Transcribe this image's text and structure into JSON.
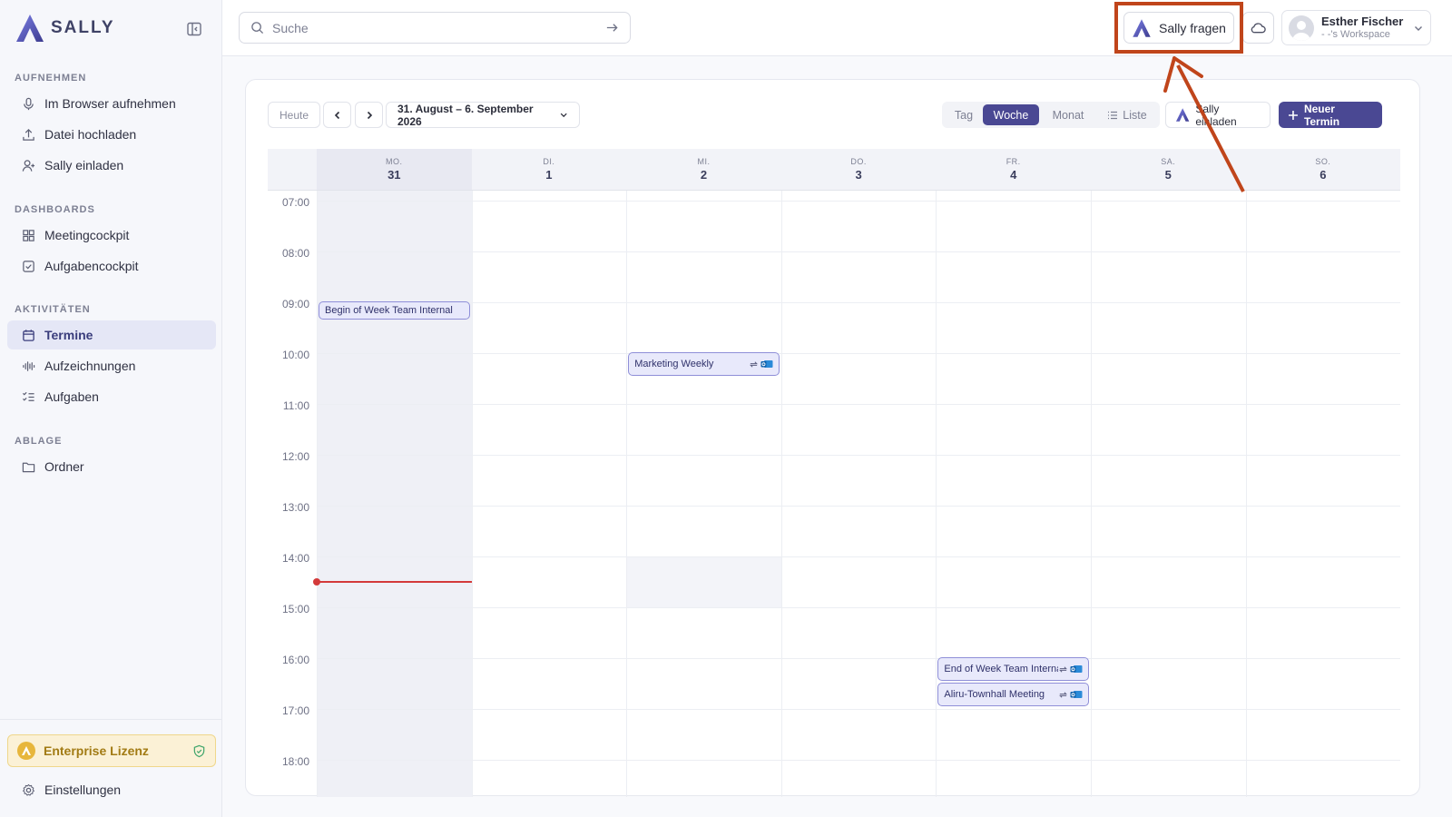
{
  "brand": {
    "name": "SALLY"
  },
  "sidebar": {
    "sections": [
      {
        "title": "AUFNEHMEN"
      },
      {
        "title": "DASHBOARDS"
      },
      {
        "title": "AKTIVITÄTEN"
      },
      {
        "title": "ABLAGE"
      }
    ],
    "items": [
      {
        "label": "Im Browser aufnehmen",
        "icon": "microphone-icon"
      },
      {
        "label": "Datei hochladen",
        "icon": "upload-icon"
      },
      {
        "label": "Sally einladen",
        "icon": "user-plus-icon"
      },
      {
        "label": "Meetingcockpit",
        "icon": "grid-icon"
      },
      {
        "label": "Aufgabencockpit",
        "icon": "checkbox-icon"
      },
      {
        "label": "Termine",
        "icon": "calendar-icon",
        "active": true
      },
      {
        "label": "Aufzeichnungen",
        "icon": "waveform-icon"
      },
      {
        "label": "Aufgaben",
        "icon": "checklist-icon"
      },
      {
        "label": "Ordner",
        "icon": "folder-icon"
      }
    ],
    "license_label": "Enterprise Lizenz",
    "settings_label": "Einstellungen"
  },
  "topbar": {
    "search_placeholder": "Suche",
    "ask_label": "Sally fragen",
    "user_name": "Esther Fischer",
    "user_workspace": "- -'s Workspace"
  },
  "toolbar": {
    "today_label": "Heute",
    "range_label": "31. August – 6. September 2026",
    "views": [
      "Tag",
      "Woche",
      "Monat",
      "Liste"
    ],
    "active_view": "Woche",
    "invite_label": "Sally einladen",
    "new_label": "Neuer Termin"
  },
  "calendar": {
    "days": [
      {
        "abbr": "MO.",
        "num": "31",
        "today": true
      },
      {
        "abbr": "DI.",
        "num": "1"
      },
      {
        "abbr": "MI.",
        "num": "2"
      },
      {
        "abbr": "DO.",
        "num": "3"
      },
      {
        "abbr": "FR.",
        "num": "4"
      },
      {
        "abbr": "SA.",
        "num": "5"
      },
      {
        "abbr": "SO.",
        "num": "6"
      }
    ],
    "hours": [
      "07:00",
      "08:00",
      "09:00",
      "10:00",
      "11:00",
      "12:00",
      "13:00",
      "14:00",
      "15:00",
      "16:00",
      "17:00",
      "18:00"
    ],
    "current_time": "14:30",
    "events": [
      {
        "title": "Begin of Week Team Internal",
        "day": "MO.",
        "start": "09:00",
        "recurring": false,
        "outlook": false
      },
      {
        "title": "Marketing Weekly",
        "day": "MI.",
        "start": "10:00",
        "recurring": true,
        "outlook": true
      },
      {
        "title": "End of Week Team Internal",
        "day": "FR.",
        "start": "16:00",
        "recurring": true,
        "outlook": true
      },
      {
        "title": "Aliru-Townhall Meeting",
        "day": "FR.",
        "start": "16:30",
        "recurring": true,
        "outlook": true
      }
    ]
  },
  "colors": {
    "accent": "#4a4893",
    "event_bg": "#e8e9fb",
    "event_border": "#8f8fd8",
    "now_line": "#d33a3a",
    "highlight": "#c0451b",
    "license_bg": "#fbf1d6"
  }
}
